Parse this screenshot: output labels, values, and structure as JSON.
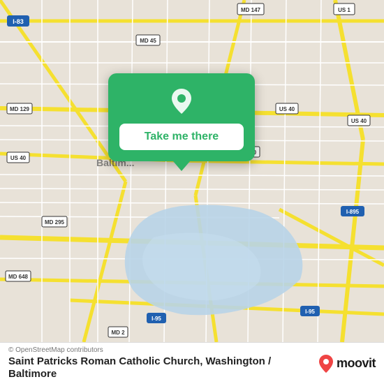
{
  "map": {
    "background_color": "#e8e0d8",
    "water_color": "#b8d4e8",
    "road_color_major": "#f5e87a",
    "road_color_highway": "#f0c040",
    "road_color_minor": "#ffffff"
  },
  "popup": {
    "button_label": "Take me there",
    "background_color": "#2eb367",
    "pin_color": "#ffffff"
  },
  "footer": {
    "attribution": "© OpenStreetMap contributors",
    "place_name": "Saint Patricks Roman Catholic Church, Washington /",
    "place_name2": "Baltimore",
    "moovit_label": "moovit"
  }
}
